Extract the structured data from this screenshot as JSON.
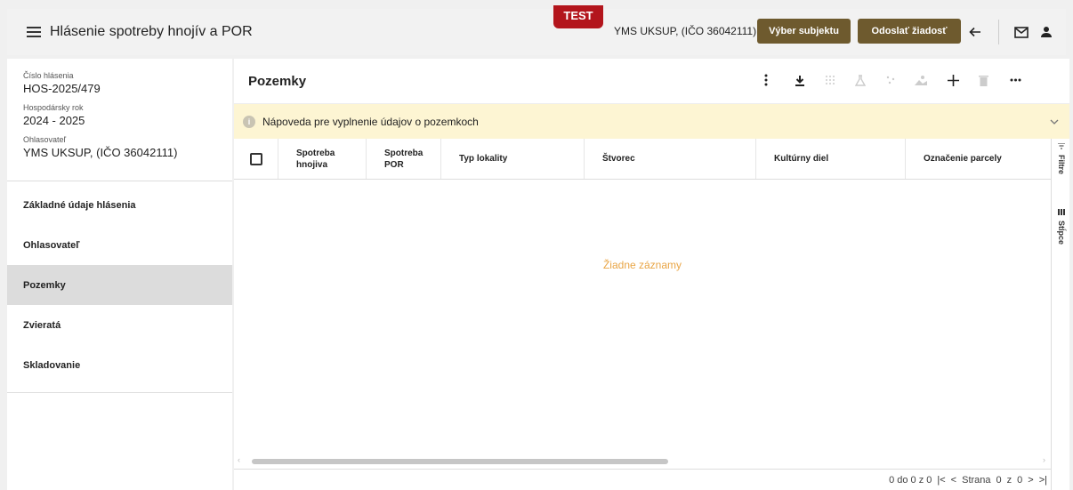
{
  "header": {
    "title": "Hlásenie spotreby hnojív a POR",
    "test_badge": "TEST",
    "subject": "YMS UKSUP, (IČO 36042111)",
    "select_subject": "Výber subjektu",
    "send_request": "Odoslať žiadosť",
    "icons": [
      "menu-icon",
      "arrow-left-icon",
      "mail-icon",
      "user-icon"
    ]
  },
  "sidebar": {
    "info": [
      {
        "label": "Číslo hlásenia",
        "value": "HOS-2025/479"
      },
      {
        "label": "Hospodársky rok",
        "value": "2024 - 2025"
      },
      {
        "label": "Ohlasovateľ",
        "value": "YMS UKSUP, (IČO 36042111)"
      }
    ],
    "items": [
      {
        "label": "Základné údaje hlásenia",
        "active": false
      },
      {
        "label": "Ohlasovateľ",
        "active": false
      },
      {
        "label": "Pozemky",
        "active": true
      },
      {
        "label": "Zvieratá",
        "active": false
      },
      {
        "label": "Skladovanie",
        "active": false
      }
    ]
  },
  "main": {
    "title": "Pozemky",
    "help_text": "Nápoveda pre vyplnenie údajov o pozemkoch",
    "columns": [
      "Spotreba hnojiva",
      "Spotreba POR",
      "Typ lokality",
      "Štvorec",
      "Kultúrny diel",
      "Označenie parcely"
    ],
    "empty_message": "Žiadne záznamy",
    "side_tabs": [
      "Filtre",
      "Stĺpce"
    ],
    "footer": {
      "range": "0 do 0 z 0",
      "page_label": "Strana",
      "page_current": "0",
      "page_of": "z",
      "page_total": "0"
    }
  },
  "colors": {
    "brand_button": "#6e5a2e",
    "test_badge": "#b3151c",
    "help_bar": "#fdf5d3",
    "empty_message": "#e9a545",
    "active_nav": "#dcdcdc"
  }
}
